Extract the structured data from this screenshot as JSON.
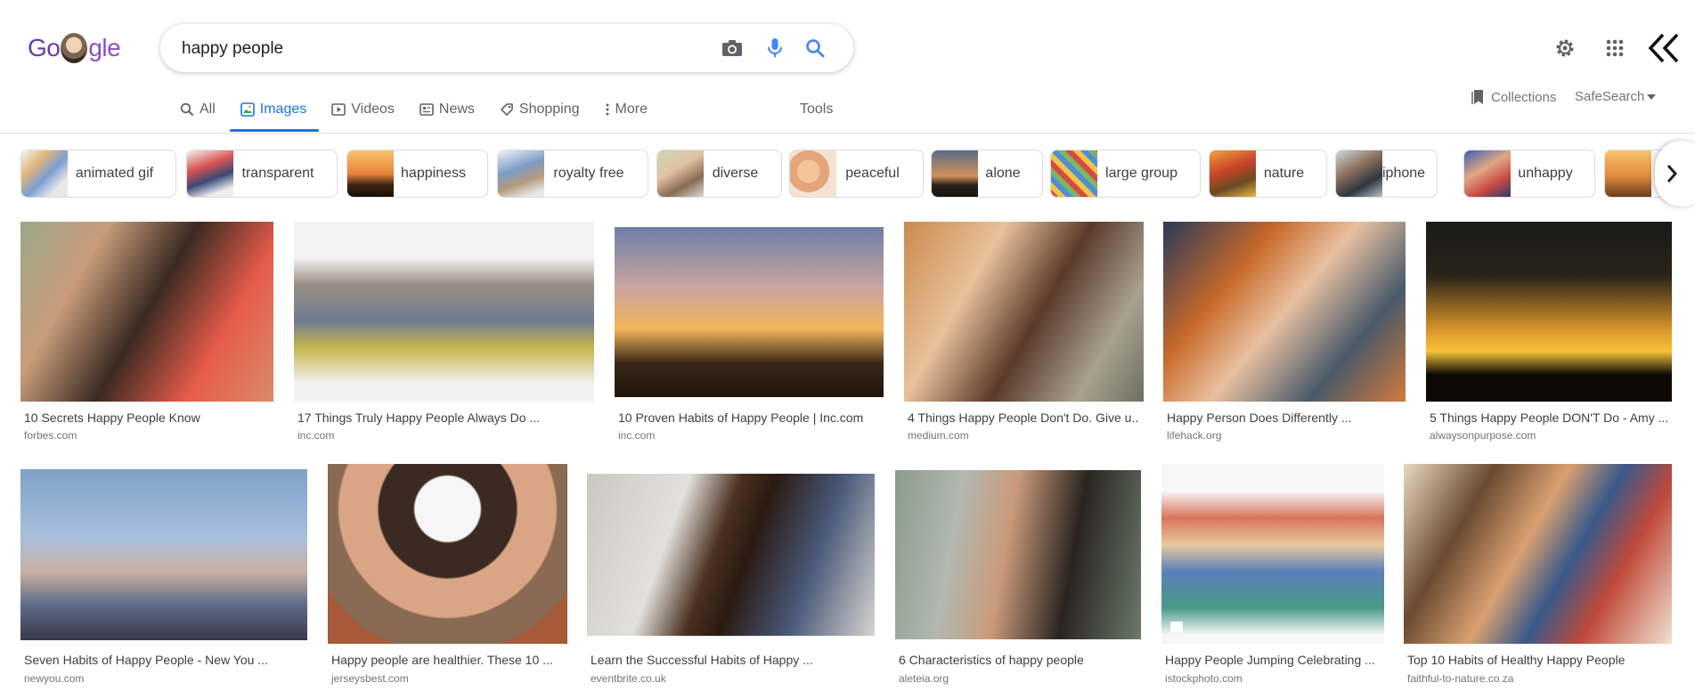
{
  "logo": {
    "text_left": "Go",
    "text_right": "gle"
  },
  "search": {
    "query": "happy people"
  },
  "icons": {
    "camera": "camera-icon",
    "mic": "microphone-icon",
    "search": "search-icon",
    "settings": "gear-icon",
    "apps": "apps-grid-icon",
    "account": "account-icon"
  },
  "tabs": [
    {
      "label": "All",
      "icon": "search-icon"
    },
    {
      "label": "Images",
      "icon": "image-icon",
      "active": true
    },
    {
      "label": "Videos",
      "icon": "play-icon"
    },
    {
      "label": "News",
      "icon": "news-icon"
    },
    {
      "label": "Shopping",
      "icon": "tag-icon"
    },
    {
      "label": "More",
      "icon": "more-vert-icon"
    }
  ],
  "tools_label": "Tools",
  "collections_label": "Collections",
  "safesearch_label": "SafeSearch",
  "chips": [
    {
      "label": "animated gif"
    },
    {
      "label": "transparent"
    },
    {
      "label": "happiness"
    },
    {
      "label": "royalty free"
    },
    {
      "label": "diverse"
    },
    {
      "label": "peaceful"
    },
    {
      "label": "alone"
    },
    {
      "label": "large group"
    },
    {
      "label": "nature"
    },
    {
      "label": "iphone"
    },
    {
      "label": "unhappy"
    },
    {
      "label": ""
    }
  ],
  "results_row1": [
    {
      "title": "10 Secrets Happy People Know",
      "source": "forbes.com"
    },
    {
      "title": "17 Things Truly Happy People Always Do ...",
      "source": "inc.com"
    },
    {
      "title": "10 Proven Habits of Happy People | Inc.com",
      "source": "inc.com"
    },
    {
      "title": "4 Things Happy People Don't Do. Give u...",
      "source": "medium.com"
    },
    {
      "title": "Happy Person Does Differently ...",
      "source": "lifehack.org"
    },
    {
      "title": "5 Things Happy People DON'T Do - Amy ...",
      "source": "alwaysonpurpose.com"
    }
  ],
  "results_row2": [
    {
      "title": "Seven Habits of Happy People - New You ...",
      "source": "newyou.com"
    },
    {
      "title": "Happy people are healthier. These 10 ...",
      "source": "jerseysbest.com"
    },
    {
      "title": "Learn the Successful Habits of Happy ...",
      "source": "eventbrite.co.uk"
    },
    {
      "title": "6 Characteristics of happy people",
      "source": "aleteia.org"
    },
    {
      "title": "Happy People Jumping Celebrating ...",
      "source": "istockphoto.com"
    },
    {
      "title": "Top 10 Habits of Healthy Happy People",
      "source": "faithful-to-nature.co.za"
    }
  ],
  "colors": {
    "accent": "#1a73e8",
    "text_secondary": "#70757a"
  }
}
